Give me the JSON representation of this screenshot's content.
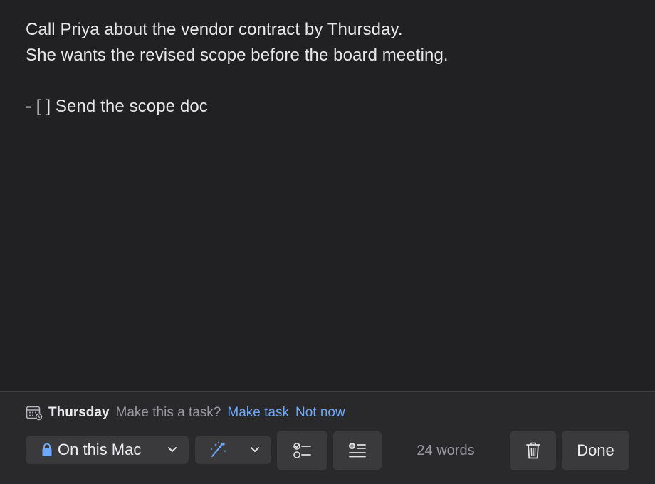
{
  "note": {
    "lines": [
      "Call Priya about the vendor contract by Thursday.",
      "She wants the revised scope before the board meeting.",
      "",
      "- [ ] Send the scope doc"
    ]
  },
  "suggestion": {
    "date": "Thursday",
    "prompt": "Make this a task?",
    "accept_label": "Make task",
    "dismiss_label": "Not now",
    "icon": "calendar-icon"
  },
  "toolbar": {
    "location_label": "On this Mac",
    "location_icon": "lock-icon",
    "magic_icon": "magic-wand-icon",
    "checklist_icon": "checklist-icon",
    "format_icon": "format-list-icon",
    "word_count": "24 words",
    "trash_icon": "trash-icon",
    "done_label": "Done"
  },
  "colors": {
    "background": "#212124",
    "bar": "#29292c",
    "button": "#3a3a3d",
    "link": "#6ea8fa",
    "lock": "#6ea8fa"
  }
}
